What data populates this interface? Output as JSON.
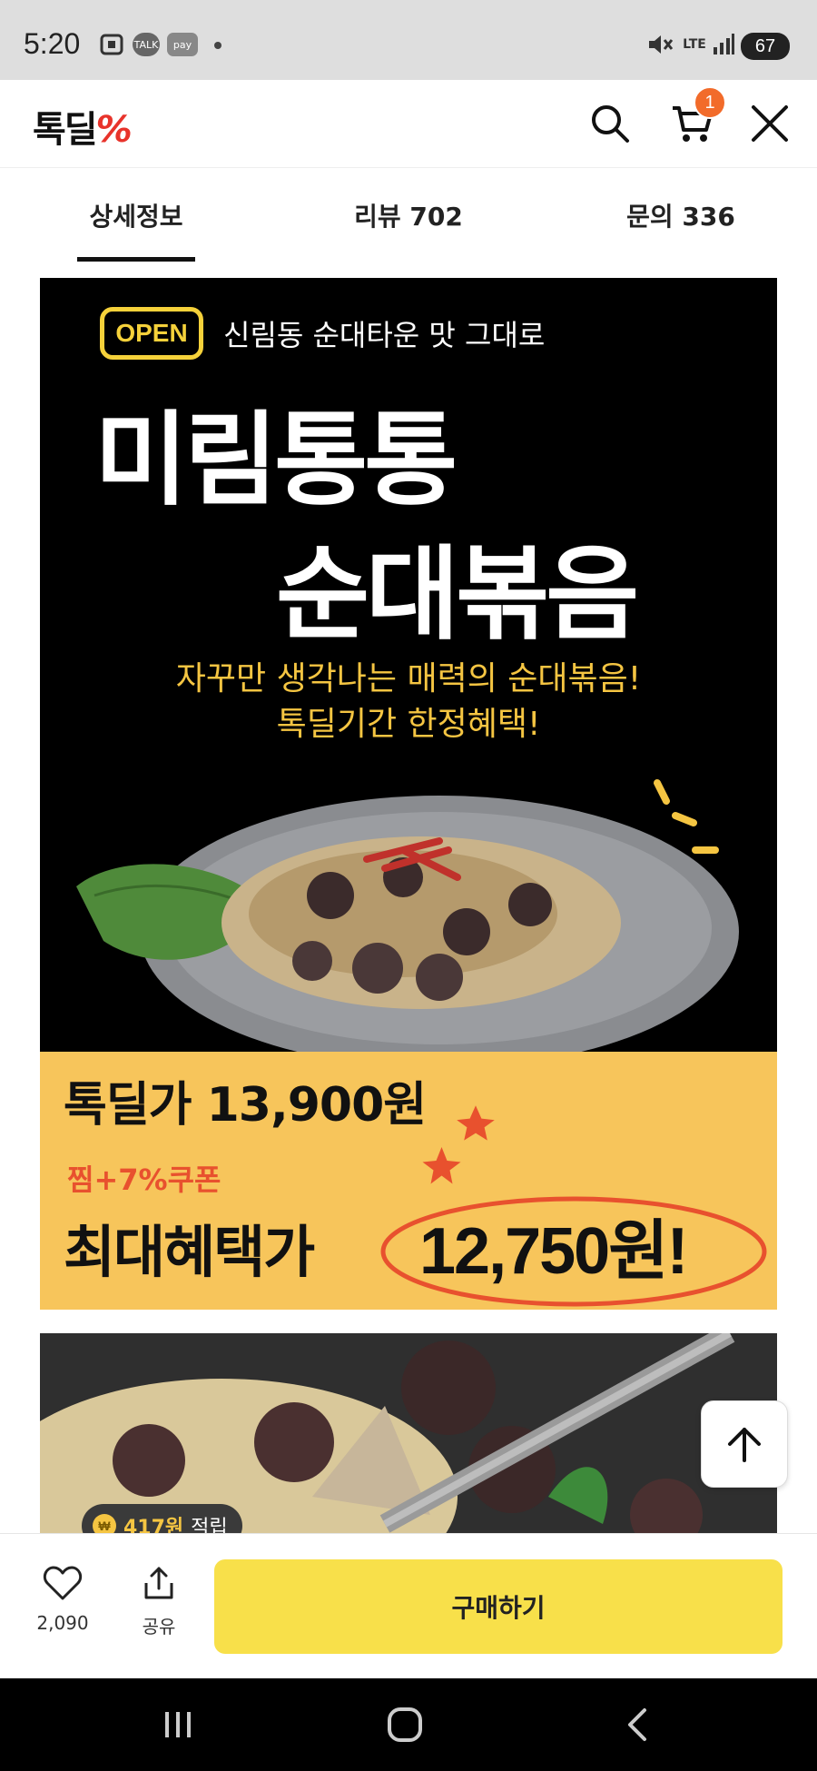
{
  "status_bar": {
    "time": "5:20",
    "icons": [
      "screenshot-icon",
      "talk-icon",
      "pay-icon",
      "dot-icon",
      "mute-icon",
      "lte-icon",
      "signal-icon"
    ],
    "talk_label": "TALK",
    "pay_label": "pay",
    "network": "LTE",
    "battery": "67"
  },
  "header": {
    "logo_text": "톡딜",
    "logo_mark": "%",
    "cart_count": "1"
  },
  "tabs": [
    {
      "label": "상세정보",
      "active": true
    },
    {
      "label": "리뷰 702",
      "active": false
    },
    {
      "label": "문의 336",
      "active": false
    }
  ],
  "banner": {
    "open_badge": "OPEN",
    "tagline": "신림동 순대타운 맛 그대로",
    "title_line1": "미림통통",
    "title_line2": "순대볶음",
    "subtitle_line1": "자꾸만 생각나는 매력의 순대볶음!",
    "subtitle_line2": "톡딜기간 한정혜택!",
    "price_label": "톡딜가 13,900원",
    "coupon_label": "찜+7%쿠폰",
    "max_benefit_label": "최대혜택가",
    "max_benefit_price": "12,750원!",
    "colors": {
      "accent_yellow": "#f5c542",
      "panel": "#f7c55b",
      "circle": "#e8512e"
    }
  },
  "points": {
    "coin_symbol": "₩",
    "value": "417원",
    "label": "적립"
  },
  "bottom_bar": {
    "like_count": "2,090",
    "share_label": "공유",
    "buy_label": "구매하기",
    "buy_color": "#f8e04a"
  }
}
